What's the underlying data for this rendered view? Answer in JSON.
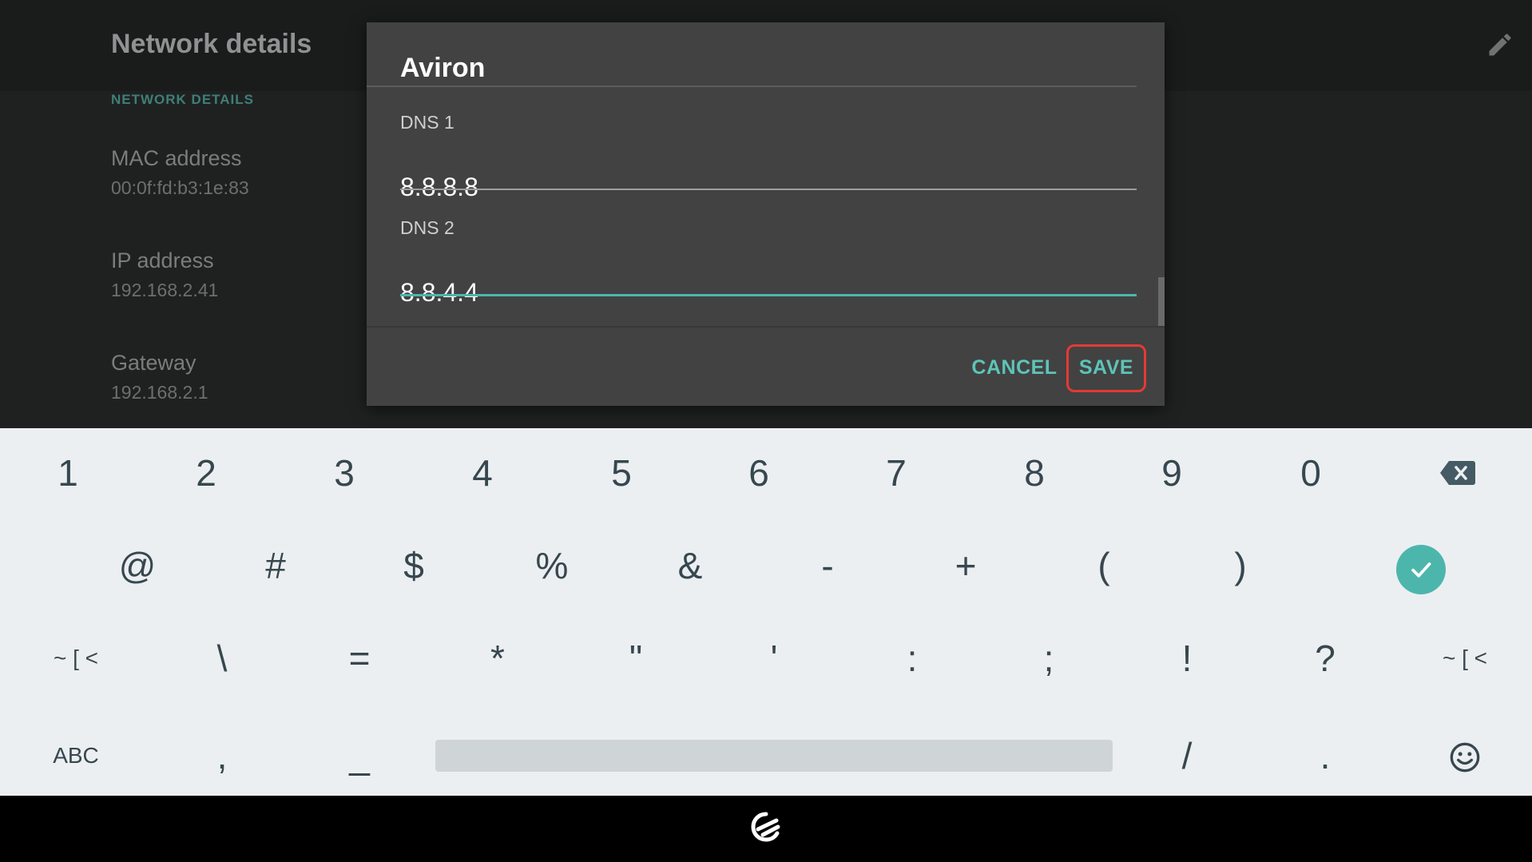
{
  "background": {
    "title": "Network details",
    "section_title": "NETWORK DETAILS",
    "items": [
      {
        "label": "MAC address",
        "value": "00:0f:fd:b3:1e:83"
      },
      {
        "label": "IP address",
        "value": "192.168.2.41"
      },
      {
        "label": "Gateway",
        "value": "192.168.2.1"
      }
    ]
  },
  "dialog": {
    "title": "Aviron",
    "dns1": {
      "label": "DNS 1",
      "value": "8.8.8.8"
    },
    "dns2": {
      "label": "DNS 2",
      "value": "8.8.4.4"
    },
    "cancel_label": "CANCEL",
    "save_label": "SAVE"
  },
  "keyboard": {
    "row1": [
      "1",
      "2",
      "3",
      "4",
      "5",
      "6",
      "7",
      "8",
      "9",
      "0"
    ],
    "row2": [
      "@",
      "#",
      "$",
      "%",
      "&",
      "-",
      "+",
      "(",
      ")"
    ],
    "row3_shift_left": "~ [ <",
    "row3": [
      "\\",
      "=",
      "*",
      "\"",
      "'",
      ":",
      ";",
      "!",
      "?"
    ],
    "row3_shift_right": "~ [ <",
    "abc_label": "ABC",
    "comma": ",",
    "underscore": "_",
    "slash": "/",
    "period": "."
  },
  "colors": {
    "accent": "#4db6ac",
    "dialog_bg": "#424242",
    "keyboard_bg": "#eceff1",
    "highlight": "#e53935"
  },
  "icons": [
    "edit-pencil-icon",
    "backspace-icon",
    "enter-check-icon",
    "emoji-icon",
    "home-logo-icon"
  ]
}
